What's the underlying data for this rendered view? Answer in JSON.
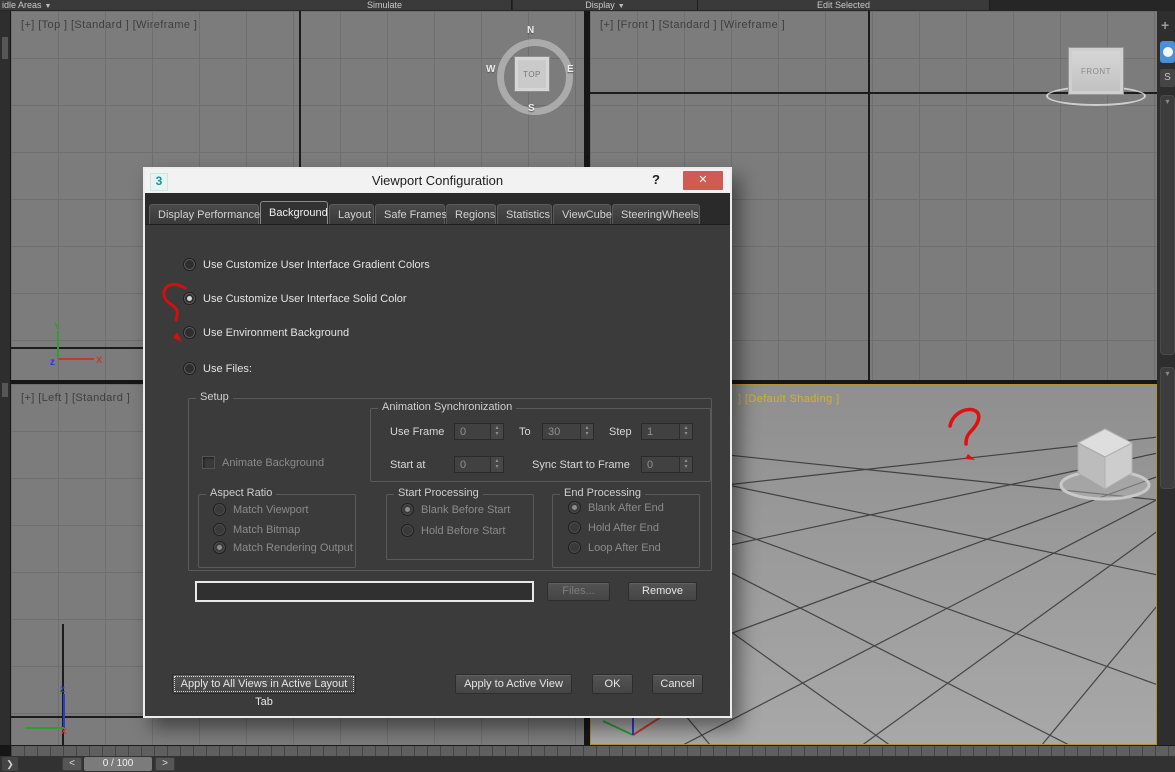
{
  "menubar": {
    "items": [
      {
        "label": "idle Areas",
        "arrow": "▼"
      },
      {
        "label": "Simulate",
        "arrow": ""
      },
      {
        "label": "Display",
        "arrow": "▼"
      },
      {
        "label": "Edit Selected",
        "arrow": ""
      }
    ]
  },
  "viewports": {
    "top_label": "[+] [Top ] [Standard ] [Wireframe ]",
    "front_label": "[+] [Front ] [Standard ] [Wireframe ]",
    "left_label": "[+] [Left ] [Standard ]",
    "persp_label": "] [Default Shading ]",
    "active_border_color": "#b5922f",
    "compass": {
      "n": "N",
      "w": "W",
      "e": "E",
      "s": "S",
      "center": "TOP"
    },
    "front_cube": "FRONT",
    "axis_top": {
      "y": "Y",
      "x": "X",
      "z": "z"
    },
    "axis_left": {
      "z": "z",
      "x": "x"
    }
  },
  "dialog": {
    "icon": "3",
    "title": "Viewport Configuration",
    "help": "?",
    "close": "✕",
    "tabs": [
      {
        "label": "Display Performance"
      },
      {
        "label": "Background"
      },
      {
        "label": "Layout"
      },
      {
        "label": "Safe Frames"
      },
      {
        "label": "Regions"
      },
      {
        "label": "Statistics"
      },
      {
        "label": "ViewCube"
      },
      {
        "label": "SteeringWheels"
      }
    ],
    "active_tab": "Background",
    "bg_options": [
      {
        "label": "Use Customize User Interface Gradient Colors",
        "selected": false
      },
      {
        "label": "Use Customize User Interface Solid Color",
        "selected": true
      },
      {
        "label": "Use Environment Background",
        "selected": false
      },
      {
        "label": "Use Files:",
        "selected": false
      }
    ],
    "setup": {
      "group_label": "Setup",
      "animate_background": "Animate Background",
      "anim_sync": {
        "group_label": "Animation Synchronization",
        "use_frame_label": "Use Frame",
        "use_frame_value": "0",
        "to_label": "To",
        "to_value": "30",
        "step_label": "Step",
        "step_value": "1",
        "start_at_label": "Start at",
        "start_at_value": "0",
        "sync_label": "Sync Start to Frame",
        "sync_value": "0"
      },
      "aspect_ratio": {
        "group_label": "Aspect Ratio",
        "options": [
          {
            "label": "Match Viewport",
            "selected": false
          },
          {
            "label": "Match Bitmap",
            "selected": false
          },
          {
            "label": "Match Rendering Output",
            "selected": true
          }
        ]
      },
      "start_processing": {
        "group_label": "Start Processing",
        "options": [
          {
            "label": "Blank Before Start",
            "selected": true
          },
          {
            "label": "Hold Before Start",
            "selected": false
          }
        ]
      },
      "end_processing": {
        "group_label": "End Processing",
        "options": [
          {
            "label": "Blank After End",
            "selected": true
          },
          {
            "label": "Hold After End",
            "selected": false
          },
          {
            "label": "Loop After End",
            "selected": false
          }
        ]
      },
      "file_input_value": "",
      "files_button": "Files...",
      "remove_button": "Remove"
    },
    "footer": {
      "apply_all": "Apply to All Views in Active Layout Tab",
      "apply_active": "Apply to Active View",
      "ok": "OK",
      "cancel": "Cancel"
    }
  },
  "timeline": {
    "prev": "<",
    "value": "0 / 100",
    "next": ">"
  },
  "side_panel": {
    "plus": "+",
    "s_label": "S"
  }
}
